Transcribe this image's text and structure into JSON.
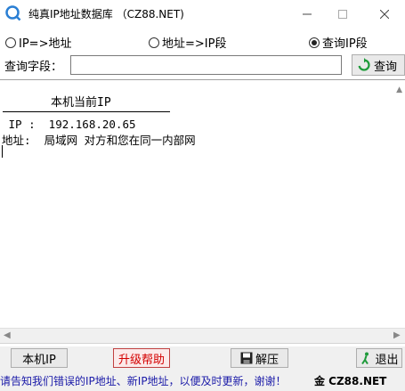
{
  "window": {
    "title": "纯真IP地址数据库 （CZ88.NET)",
    "minimize_glyph": "—",
    "maximize_glyph": "☐",
    "close_glyph": "✕"
  },
  "search_modes": [
    {
      "label": "IP=>地址",
      "checked": false
    },
    {
      "label": "地址=>IP段",
      "checked": false
    },
    {
      "label": "查询IP段",
      "checked": true
    }
  ],
  "query": {
    "label": "查询字段：",
    "value": "",
    "placeholder": "",
    "button_label": "查询",
    "button_icon": "refresh-icon"
  },
  "result": {
    "heading": "本机当前IP",
    "ip_line": " IP :  192.168.20.65",
    "address_line": "地址:  局域网 对方和您在同一内部网"
  },
  "toolbar": {
    "local_ip_label": "本机IP",
    "upgrade_label": "升级帮助",
    "unzip_label": "解压",
    "unzip_icon": "save-icon",
    "exit_label": "退出",
    "exit_icon": "exit-icon"
  },
  "status": {
    "message": "请告知我们错误的IP地址、新IP地址，以便及时更新，谢谢！",
    "brand": "金 CZ88.NET"
  },
  "colors": {
    "upgrade_text": "#d40000",
    "status_text": "#1a1aa8",
    "refresh_icon": "#1e9a3a"
  }
}
